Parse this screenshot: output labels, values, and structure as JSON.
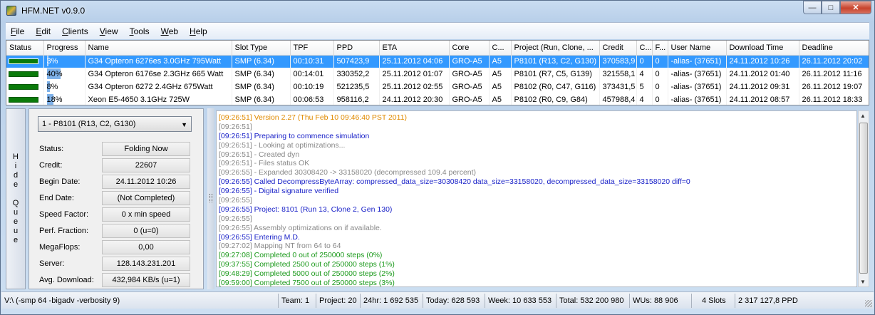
{
  "window": {
    "title": "HFM.NET v0.9.0"
  },
  "menu": [
    "File",
    "Edit",
    "Clients",
    "View",
    "Tools",
    "Web",
    "Help"
  ],
  "menu_underline": [
    "F",
    "E",
    "C",
    "V",
    "T",
    "W",
    "H"
  ],
  "grid": {
    "columns": [
      "Status",
      "Progress",
      "Name",
      "Slot Type",
      "TPF",
      "PPD",
      "ETA",
      "Core",
      "C...",
      "Project (Run, Clone, ...",
      "Credit",
      "C...",
      "F...",
      "User Name",
      "Download Time",
      "Deadline"
    ],
    "rows": [
      {
        "progress": "3%",
        "progress_frac": 0.03,
        "name": "G34 Opteron 6276es 3.0GHz 795Watt",
        "slot": "SMP (6.34)",
        "tpf": "00:10:31",
        "ppd": "507423,9",
        "eta": "25.11.2012 04:06",
        "core": "GRO-A5",
        "c": "A5",
        "project": "P8101 (R13, C2, G130)",
        "credit": "370583,9",
        "c2": "0",
        "f": "0",
        "user": "-alias- (37651)",
        "download": "24.11.2012 10:26",
        "deadline": "26.11.2012 20:02"
      },
      {
        "progress": "40%",
        "progress_frac": 0.4,
        "name": "G34 Opteron 6176se 2.3GHz 665 Watt",
        "slot": "SMP (6.34)",
        "tpf": "00:14:01",
        "ppd": "330352,2",
        "eta": "25.11.2012 01:07",
        "core": "GRO-A5",
        "c": "A5",
        "project": "P8101 (R7, C5, G139)",
        "credit": "321558,1",
        "c2": "4",
        "f": "0",
        "user": "-alias- (37651)",
        "download": "24.11.2012 01:40",
        "deadline": "26.11.2012 11:16"
      },
      {
        "progress": "8%",
        "progress_frac": 0.08,
        "name": "G34 Opteron 6272 2.4GHz 675Watt",
        "slot": "SMP (6.34)",
        "tpf": "00:10:19",
        "ppd": "521235,5",
        "eta": "25.11.2012 02:55",
        "core": "GRO-A5",
        "c": "A5",
        "project": "P8102 (R0, C47, G116)",
        "credit": "373431,5",
        "c2": "5",
        "f": "0",
        "user": "-alias- (37651)",
        "download": "24.11.2012 09:31",
        "deadline": "26.11.2012 19:07"
      },
      {
        "progress": "18%",
        "progress_frac": 0.18,
        "name": "Xeon E5-4650 3.1GHz 725W",
        "slot": "SMP (6.34)",
        "tpf": "00:06:53",
        "ppd": "958116,2",
        "eta": "24.11.2012 20:30",
        "core": "GRO-A5",
        "c": "A5",
        "project": "P8102 (R0, C9, G84)",
        "credit": "457988,4",
        "c2": "4",
        "f": "0",
        "user": "-alias- (37651)",
        "download": "24.11.2012 08:57",
        "deadline": "26.11.2012 18:33"
      }
    ]
  },
  "hide_queue": [
    "H",
    "i",
    "d",
    "e",
    "",
    "Q",
    "u",
    "e",
    "u",
    "e"
  ],
  "details": {
    "selected": "1 - P8101 (R13, C2, G130)",
    "fields": [
      {
        "label": "Status:",
        "value": "Folding Now"
      },
      {
        "label": "Credit:",
        "value": "22607"
      },
      {
        "label": "Begin Date:",
        "value": "24.11.2012 10:26"
      },
      {
        "label": "End Date:",
        "value": "(Not Completed)"
      },
      {
        "label": "Speed Factor:",
        "value": "0 x min speed"
      },
      {
        "label": "Perf. Fraction:",
        "value": "0 (u=0)"
      },
      {
        "label": "MegaFlops:",
        "value": "0,00"
      },
      {
        "label": "Server:",
        "value": "128.143.231.201"
      },
      {
        "label": "Avg. Download:",
        "value": "432,984 KB/s (u=1)"
      }
    ]
  },
  "log": [
    {
      "text": "[09:26:51] Version 2.27 (Thu Feb 10 09:46:40 PST 2011)",
      "color": "orange"
    },
    {
      "text": "[09:26:51]",
      "color": "gray"
    },
    {
      "text": "[09:26:51] Preparing to commence simulation",
      "color": "blue"
    },
    {
      "text": "[09:26:51] - Looking at optimizations...",
      "color": "gray"
    },
    {
      "text": "[09:26:51] - Created dyn",
      "color": "gray"
    },
    {
      "text": "[09:26:51] - Files status OK",
      "color": "gray"
    },
    {
      "text": "[09:26:55] - Expanded 30308420 -> 33158020 (decompressed 109.4 percent)",
      "color": "gray"
    },
    {
      "text": "[09:26:55] Called DecompressByteArray: compressed_data_size=30308420 data_size=33158020, decompressed_data_size=33158020 diff=0",
      "color": "blue"
    },
    {
      "text": "[09:26:55] - Digital signature verified",
      "color": "blue"
    },
    {
      "text": "[09:26:55]",
      "color": "gray"
    },
    {
      "text": "[09:26:55] Project: 8101 (Run 13, Clone 2, Gen 130)",
      "color": "blue"
    },
    {
      "text": "[09:26:55]",
      "color": "gray"
    },
    {
      "text": "[09:26:55] Assembly optimizations on if available.",
      "color": "gray"
    },
    {
      "text": "[09:26:55] Entering M.D.",
      "color": "blue"
    },
    {
      "text": "[09:27:02] Mapping NT from 64 to 64",
      "color": "gray"
    },
    {
      "text": "[09:27:08] Completed 0 out of 250000 steps  (0%)",
      "color": "green"
    },
    {
      "text": "[09:37:55] Completed 2500 out of 250000 steps  (1%)",
      "color": "green"
    },
    {
      "text": "[09:48:29] Completed 5000 out of 250000 steps  (2%)",
      "color": "green"
    },
    {
      "text": "[09:59:00] Completed 7500 out of 250000 steps  (3%)",
      "color": "green"
    }
  ],
  "statusbar": {
    "path": "V:\\ (-smp 64 -bigadv -verbosity 9)",
    "team": "Team: 1",
    "project": "Project: 20",
    "h24": "24hr: 1 692 535",
    "today": "Today: 628 593",
    "week": "Week: 10 633 553",
    "total": "Total: 532 200 980",
    "wus": "WUs: 88 906",
    "slots": "4 Slots",
    "ppd": "2 317 127,8 PPD"
  },
  "colors": {
    "selection": "#3399ff",
    "status_running": "#0a7a0a"
  }
}
